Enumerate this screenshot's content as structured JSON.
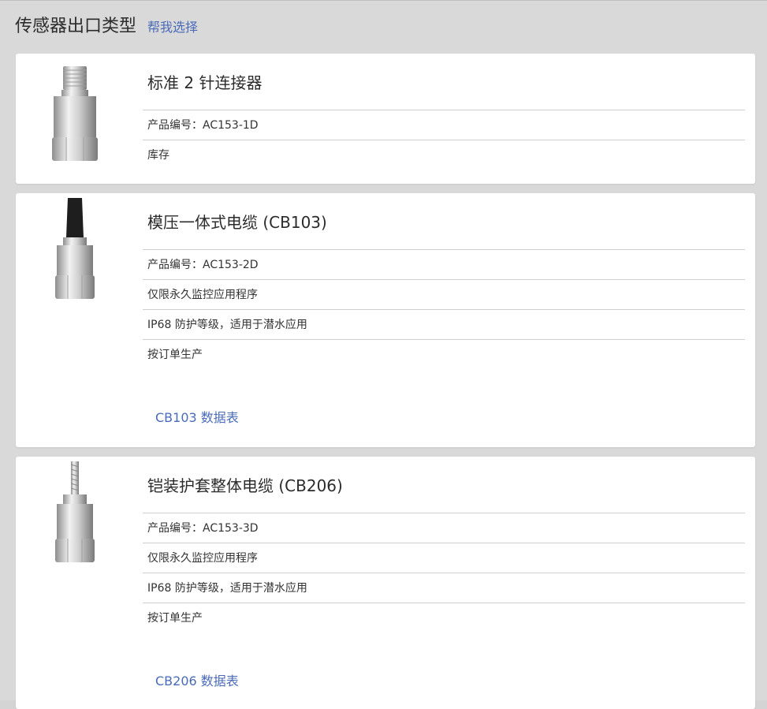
{
  "header": {
    "title": "传感器出口类型",
    "help_link": "帮我选择"
  },
  "cards": [
    {
      "title": "标准 2 针连接器",
      "rows": [
        "产品编号：AC153-1D",
        "库存"
      ],
      "image": "sensor-connector-image"
    },
    {
      "title": "模压一体式电缆 (CB103)",
      "rows": [
        "产品编号：AC153-2D",
        "仅限永久监控应用程序",
        "IP68 防护等级，适用于潜水应用",
        "按订单生产"
      ],
      "datasheet": "CB103 数据表",
      "image": "sensor-molded-cable-image"
    },
    {
      "title": "铠装护套整体电缆 (CB206)",
      "rows": [
        "产品编号：AC153-3D",
        "仅限永久监控应用程序",
        "IP68 防护等级，适用于潜水应用",
        "按订单生产"
      ],
      "datasheet": "CB206 数据表",
      "image": "sensor-armored-cable-image"
    }
  ],
  "colors": {
    "link": "#4a6bb8",
    "background": "#d9d9d9",
    "card": "#ffffff",
    "divider": "#cfcfcf"
  }
}
